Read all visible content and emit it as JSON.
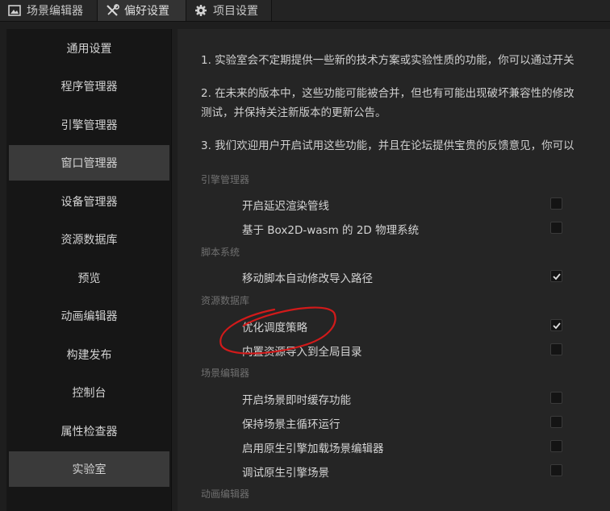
{
  "tabs": [
    {
      "label": "场景编辑器",
      "icon": "scene-image-icon"
    },
    {
      "label": "偏好设置",
      "icon": "tools-icon",
      "active": true
    },
    {
      "label": "项目设置",
      "icon": "gear-icon"
    }
  ],
  "sidebar": {
    "items": [
      {
        "label": "通用设置"
      },
      {
        "label": "程序管理器"
      },
      {
        "label": "引擎管理器"
      },
      {
        "label": "窗口管理器",
        "active": true
      },
      {
        "label": "设备管理器"
      },
      {
        "label": "资源数据库"
      },
      {
        "label": "预览"
      },
      {
        "label": "动画编辑器"
      },
      {
        "label": "构建发布"
      },
      {
        "label": "控制台"
      },
      {
        "label": "属性检查器"
      },
      {
        "label": "实验室",
        "active": true
      }
    ]
  },
  "main": {
    "paragraphs": [
      "1. 实验室会不定期提供一些新的技术方案或实验性质的功能，你可以通过开关",
      "2. 在未来的版本中，这些功能可能被合并，但也有可能出现破坏兼容性的修改",
      "测试，并保持关注新版本的更新公告。",
      "3. 我们欢迎用户开启试用这些功能，并且在论坛提供宝贵的反馈意见，你可以"
    ],
    "sections": [
      {
        "title": "引擎管理器",
        "options": [
          {
            "label": "开启延迟渲染管线",
            "checked": false
          },
          {
            "label": "基于 Box2D-wasm 的 2D 物理系统",
            "checked": false
          }
        ]
      },
      {
        "title": "脚本系统",
        "options": [
          {
            "label": "移动脚本自动修改导入路径",
            "checked": true
          }
        ]
      },
      {
        "title": "资源数据库",
        "options": [
          {
            "label": "优化调度策略",
            "checked": true
          },
          {
            "label": "内置资源导入到全局目录",
            "checked": false
          }
        ]
      },
      {
        "title": "场景编辑器",
        "options": [
          {
            "label": "开启场景即时缓存功能",
            "checked": false
          },
          {
            "label": "保持场景主循环运行",
            "checked": false
          },
          {
            "label": "启用原生引擎加载场景编辑器",
            "checked": false
          },
          {
            "label": "调试原生引擎场景",
            "checked": false
          }
        ]
      },
      {
        "title": "动画编辑器",
        "options": []
      }
    ]
  },
  "colors": {
    "annotation": "#d21a1a",
    "active_sidebar": "#3a3a3a",
    "panel_bg": "#252525"
  }
}
